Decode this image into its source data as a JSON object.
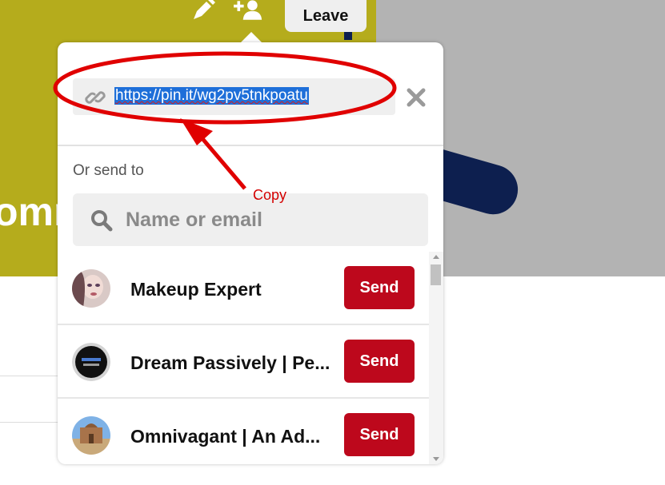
{
  "background": {
    "title_fragment": "omn",
    "colors": {
      "olive": "#b5ac1c",
      "gray": "#b3b3b3",
      "navy": "#0d1f4f"
    }
  },
  "top_bar": {
    "edit_icon": "pencil-icon",
    "add_collaborator_icon": "add-user-icon",
    "leave_label": "Leave"
  },
  "share": {
    "link_icon": "link-icon",
    "link_url": "https://pin.it/wg2pv5tnkpoatu",
    "close_icon": "close-icon",
    "or_send_to": "Or send to",
    "search_placeholder": "Name or email",
    "search_icon": "search-icon",
    "contacts": [
      {
        "name": "Makeup Expert",
        "send_label": "Send"
      },
      {
        "name": "Dream Passively | Pe...",
        "send_label": "Send"
      },
      {
        "name": "Omnivagant | An Ad...",
        "send_label": "Send"
      }
    ],
    "send_color": "#bd081c"
  },
  "annotation": {
    "label": "Copy",
    "color": "#d40000"
  }
}
